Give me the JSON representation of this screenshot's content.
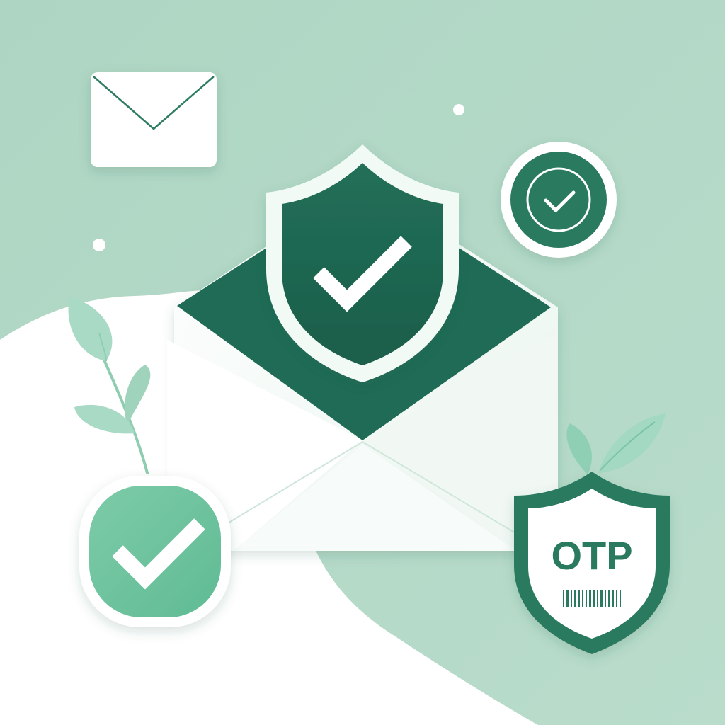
{
  "otp_badge": {
    "label": "OTP"
  },
  "colors": {
    "background": "#b3d8c6",
    "dark_green": "#1f6b55",
    "mid_green": "#2e7d64",
    "light_green": "#6cc29d",
    "leaf_green": "#a8d8c4",
    "white": "#ffffff"
  },
  "icons": [
    "mail-icon",
    "shield-check-icon",
    "check-circle-icon",
    "check-square-icon",
    "otp-shield-icon",
    "leaf-icon",
    "barcode-icon"
  ]
}
